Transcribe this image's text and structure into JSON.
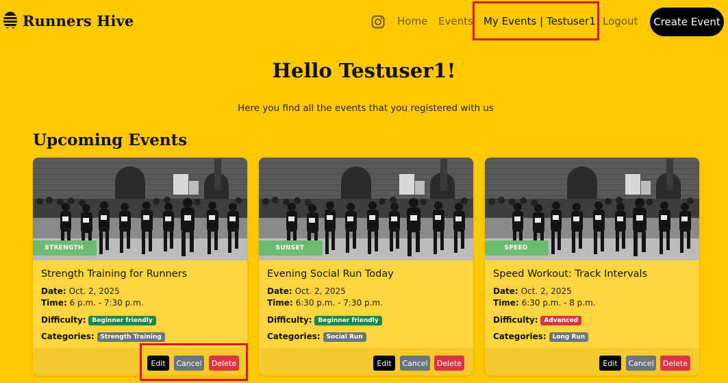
{
  "brand": {
    "name": "Runners Hive",
    "logo_icon": "beehive-icon"
  },
  "nav": {
    "instagram_icon": "instagram-icon",
    "home": "Home",
    "events": "Events",
    "my_events": "My Events | Testuser1",
    "logout": "Logout",
    "create": "Create Event"
  },
  "page": {
    "greeting": "Hello Testuser1!",
    "subtitle": "Here you find all the events that you registered with us",
    "section": "Upcoming Events"
  },
  "labels": {
    "date": "Date:",
    "time": "Time:",
    "difficulty": "Difficulty:",
    "categories": "Categories:"
  },
  "buttons": {
    "edit": "Edit",
    "cancel": "Cancel",
    "delete": "Delete"
  },
  "colors": {
    "background": "#ffc800",
    "card": "#fdd53e",
    "ribbon": "#6dbb72",
    "highlight": "#e0141e"
  },
  "events": [
    {
      "tag": "STRENGTH",
      "title": "Strength Training for Runners",
      "date": "Oct. 2, 2025",
      "time": "6 p.m. - 7:30 p.m.",
      "difficulty": "Beginner friendly",
      "difficulty_color": "green",
      "category": "Strength Training"
    },
    {
      "tag": "SUNSET",
      "title": "Evening Social Run Today",
      "date": "Oct. 2, 2025",
      "time": "6:30 p.m. - 7:30 p.m.",
      "difficulty": "Beginner friendly",
      "difficulty_color": "green",
      "category": "Social Run"
    },
    {
      "tag": "SPEED",
      "title": "Speed Workout: Track Intervals",
      "date": "Oct. 2, 2025",
      "time": "6:30 p.m. - 8 p.m.",
      "difficulty": "Advanced",
      "difficulty_color": "red",
      "category": "Long Run"
    }
  ]
}
